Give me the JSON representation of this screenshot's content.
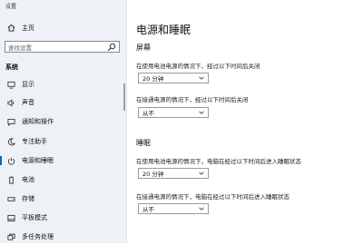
{
  "window_title": "设置",
  "sidebar": {
    "home_label": "主页",
    "search_placeholder": "查找设置",
    "section_label": "系统",
    "items": [
      {
        "label": "显示",
        "icon": "display-icon"
      },
      {
        "label": "声音",
        "icon": "speaker-icon"
      },
      {
        "label": "通知和操作",
        "icon": "notification-icon"
      },
      {
        "label": "专注助手",
        "icon": "moon-icon"
      },
      {
        "label": "电源和睡眠",
        "icon": "power-icon",
        "active": true
      },
      {
        "label": "电池",
        "icon": "battery-icon"
      },
      {
        "label": "存储",
        "icon": "storage-icon"
      },
      {
        "label": "平板模式",
        "icon": "tablet-icon"
      },
      {
        "label": "多任务处理",
        "icon": "multitask-icon"
      }
    ]
  },
  "main": {
    "title": "电源和睡眠",
    "screen": {
      "heading": "屏幕",
      "battery_label": "在使用电池电源的情况下，经过以下时间后关闭",
      "battery_value": "20 分钟",
      "plugged_label": "在接通电源的情况下，经过以下时间后关闭",
      "plugged_value": "从不"
    },
    "sleep": {
      "heading": "睡眠",
      "battery_label": "在使用电池电源的情况下，电脑在经过以下时间后进入睡眠状态",
      "battery_value": "20 分钟",
      "plugged_label": "在接通电源的情况下，电脑在经过以下时间后进入睡眠状态",
      "plugged_value": "从不"
    }
  },
  "colors": {
    "accent": "#0067c0",
    "sidebar_bg": "#eef2f7"
  }
}
